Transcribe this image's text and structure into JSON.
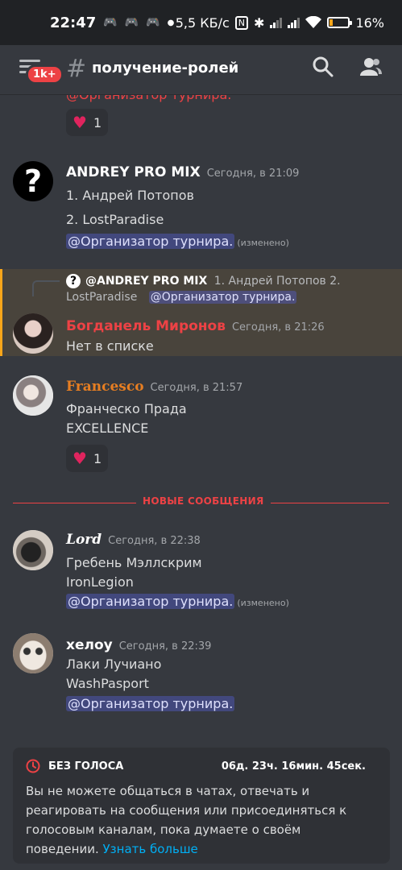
{
  "status_bar": {
    "time": "22:47",
    "network_speed": "5,5 КБ/с",
    "battery_percent": "16%",
    "battery_level": 0.16,
    "icons": [
      "gamepad-icon",
      "gamepad-icon",
      "gamepad-icon",
      "dot-icon",
      "nfc-icon",
      "bluetooth-icon",
      "signal-icon",
      "signal-icon",
      "wifi-icon",
      "battery-icon"
    ]
  },
  "header": {
    "unread_badge": "1k+",
    "channel_name": "получение-ролей",
    "icons": [
      "menu-icon",
      "hash-icon",
      "search-icon",
      "members-icon"
    ]
  },
  "chat": {
    "cut_mention": "@Организатор турнира.",
    "reactions": [
      {
        "emoji": "heart",
        "count": "1"
      },
      {
        "emoji": "heart",
        "count": "1"
      }
    ],
    "messages": [
      {
        "author": "ANDREY PRO MIX",
        "author_color": "#ffffff",
        "timestamp": "Сегодня, в 21:09",
        "lines": [
          "1.  Андрей Потопов",
          "2.  LostParadise"
        ],
        "mention": "@Организатор турнира.",
        "edited": "(изменено)"
      },
      {
        "reply": {
          "author": "@ANDREY PRO MIX",
          "text_line1": "1.  Андрей Потопов     2.",
          "text_line2": "LostParadise",
          "mention": "@Организатор турнира."
        },
        "author": "Богданель Миронов",
        "author_color": "#ed4245",
        "timestamp": "Сегодня, в 21:26",
        "lines": [
          "Нет в списке"
        ]
      },
      {
        "author": "Francesco",
        "author_color": "#e67e22",
        "timestamp": "Сегодня, в 21:57",
        "lines": [
          "Франческо Прада",
          "EXCELLENCE"
        ]
      },
      {
        "author": "Lord",
        "author_color": "#ffffff",
        "timestamp": "Сегодня, в 22:38",
        "lines": [
          "Гребень Мэллскрим",
          "IronLegion"
        ],
        "mention": "@Организатор турнира.",
        "edited": "(изменено)"
      },
      {
        "author": "хелоу",
        "author_color": "#ffffff",
        "timestamp": "Сегодня, в 22:39",
        "lines": [
          "Лаки Лучиано",
          "WashPasport"
        ],
        "mention": "@Организатор турнира."
      }
    ],
    "new_messages_divider": "НОВЫЕ СООБЩЕНИЯ"
  },
  "timeout_banner": {
    "title": "БЕЗ ГОЛОСА",
    "countdown": "06д. 23ч. 16мин. 45сек.",
    "text": "Вы не можете общаться в чатах, отвечать и реагировать на сообщения или присоединяться к голосовым каналам, пока думаете о своём поведении.",
    "link": "Узнать больше"
  },
  "colors": {
    "background": "#36393f",
    "mention_bg": "#4f5795",
    "accent_red": "#ed4245",
    "highlight": "#49443c",
    "link": "#00aff4"
  }
}
